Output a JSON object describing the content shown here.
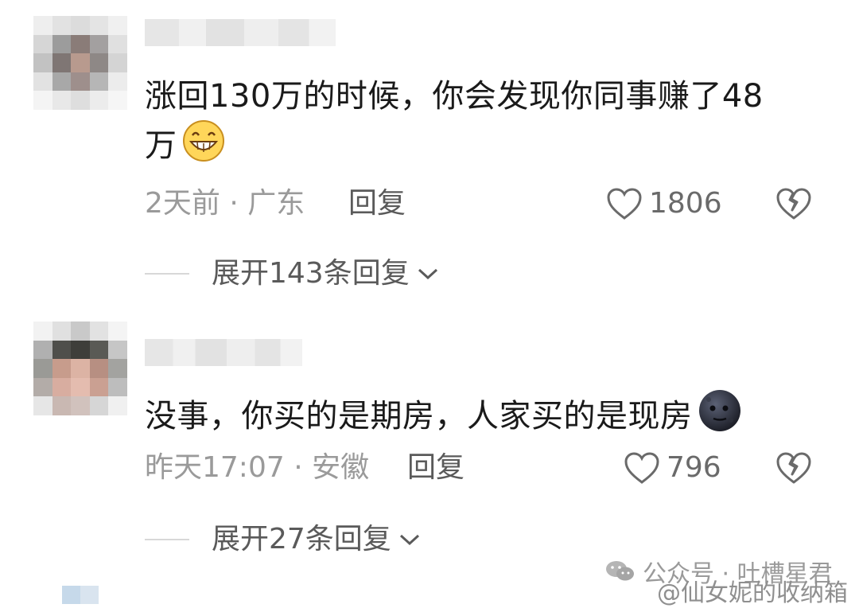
{
  "comments": [
    {
      "text": "涨回130万的时候，你会发现你同事赚了48",
      "text2": "万",
      "emoji": "grinning-face-emoji",
      "meta": "2天前 · 广东",
      "reply": "回复",
      "likes": "1806",
      "expand": "展开143条回复"
    },
    {
      "text": "没事，你买的是期房，人家买的是现房",
      "emoji": "dark-moon-face-emoji",
      "meta": "昨天17:07 · 安徽",
      "reply": "回复",
      "likes": "796",
      "expand": "展开27条回复"
    }
  ],
  "watermark": {
    "line1": "公众号 · 吐槽星君",
    "line2": "@仙女妮的收纳箱"
  },
  "icons": {
    "like": "heart-outline-icon",
    "dislike": "broken-heart-icon",
    "expand": "chevron-down-icon",
    "wechat": "wechat-logo-icon"
  }
}
